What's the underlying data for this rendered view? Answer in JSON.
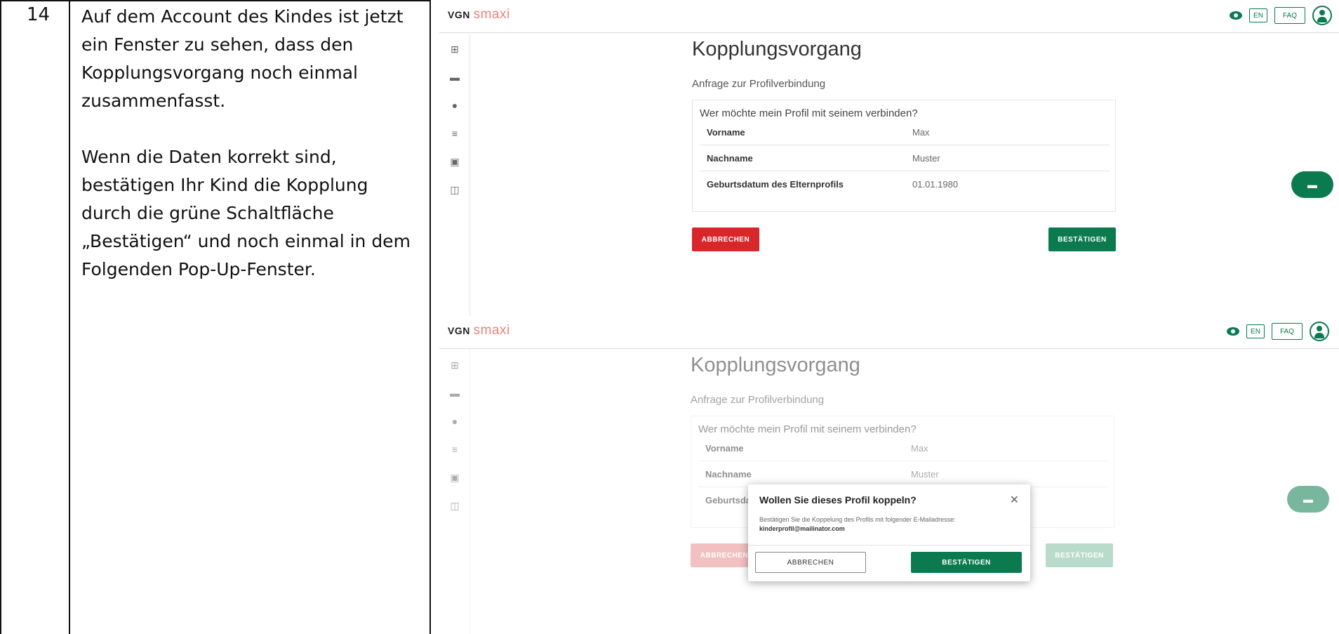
{
  "step": "14",
  "instructions": {
    "p1": "Auf dem Account des Kindes ist jetzt ein Fenster zu sehen, dass den Kopplungsvorgang noch einmal zusammenfasst.",
    "p2": "Wenn die Daten korrekt sind, bestätigen Ihr Kind die Kopplung durch die grüne Schaltfläche „Bestätigen“ und noch einmal in dem Folgenden Pop-Up-Fenster."
  },
  "app": {
    "logo_vgn": "VGN",
    "logo_smaxi": "smaxi",
    "lang": "EN",
    "faq": "FAQ"
  },
  "page": {
    "title": "Kopplungsvorgang",
    "subtitle": "Anfrage zur Profilverbindung",
    "question": "Wer möchte mein Profil mit seinem verbinden?",
    "rows": [
      {
        "label": "Vorname",
        "value": "Max"
      },
      {
        "label": "Nachname",
        "value": "Muster"
      },
      {
        "label": "Geburtsdatum des Elternprofils",
        "value": "01.01.1980"
      }
    ],
    "cancel": "ABBRECHEN",
    "confirm": "BESTÄTIGEN"
  },
  "modal": {
    "title": "Wollen Sie dieses Profil koppeln?",
    "text": "Bestätigen Sie die Koppelung des Profils mit folgender E-Mailadresse:",
    "email": "kinderprofil@mailinator.com",
    "cancel": "ABBRECHEN",
    "confirm": "BESTÄTIGEN"
  },
  "colors": {
    "brand_green": "#0b7a4f",
    "cancel_red": "#d9262b",
    "logo_orange": "#e8837a"
  }
}
